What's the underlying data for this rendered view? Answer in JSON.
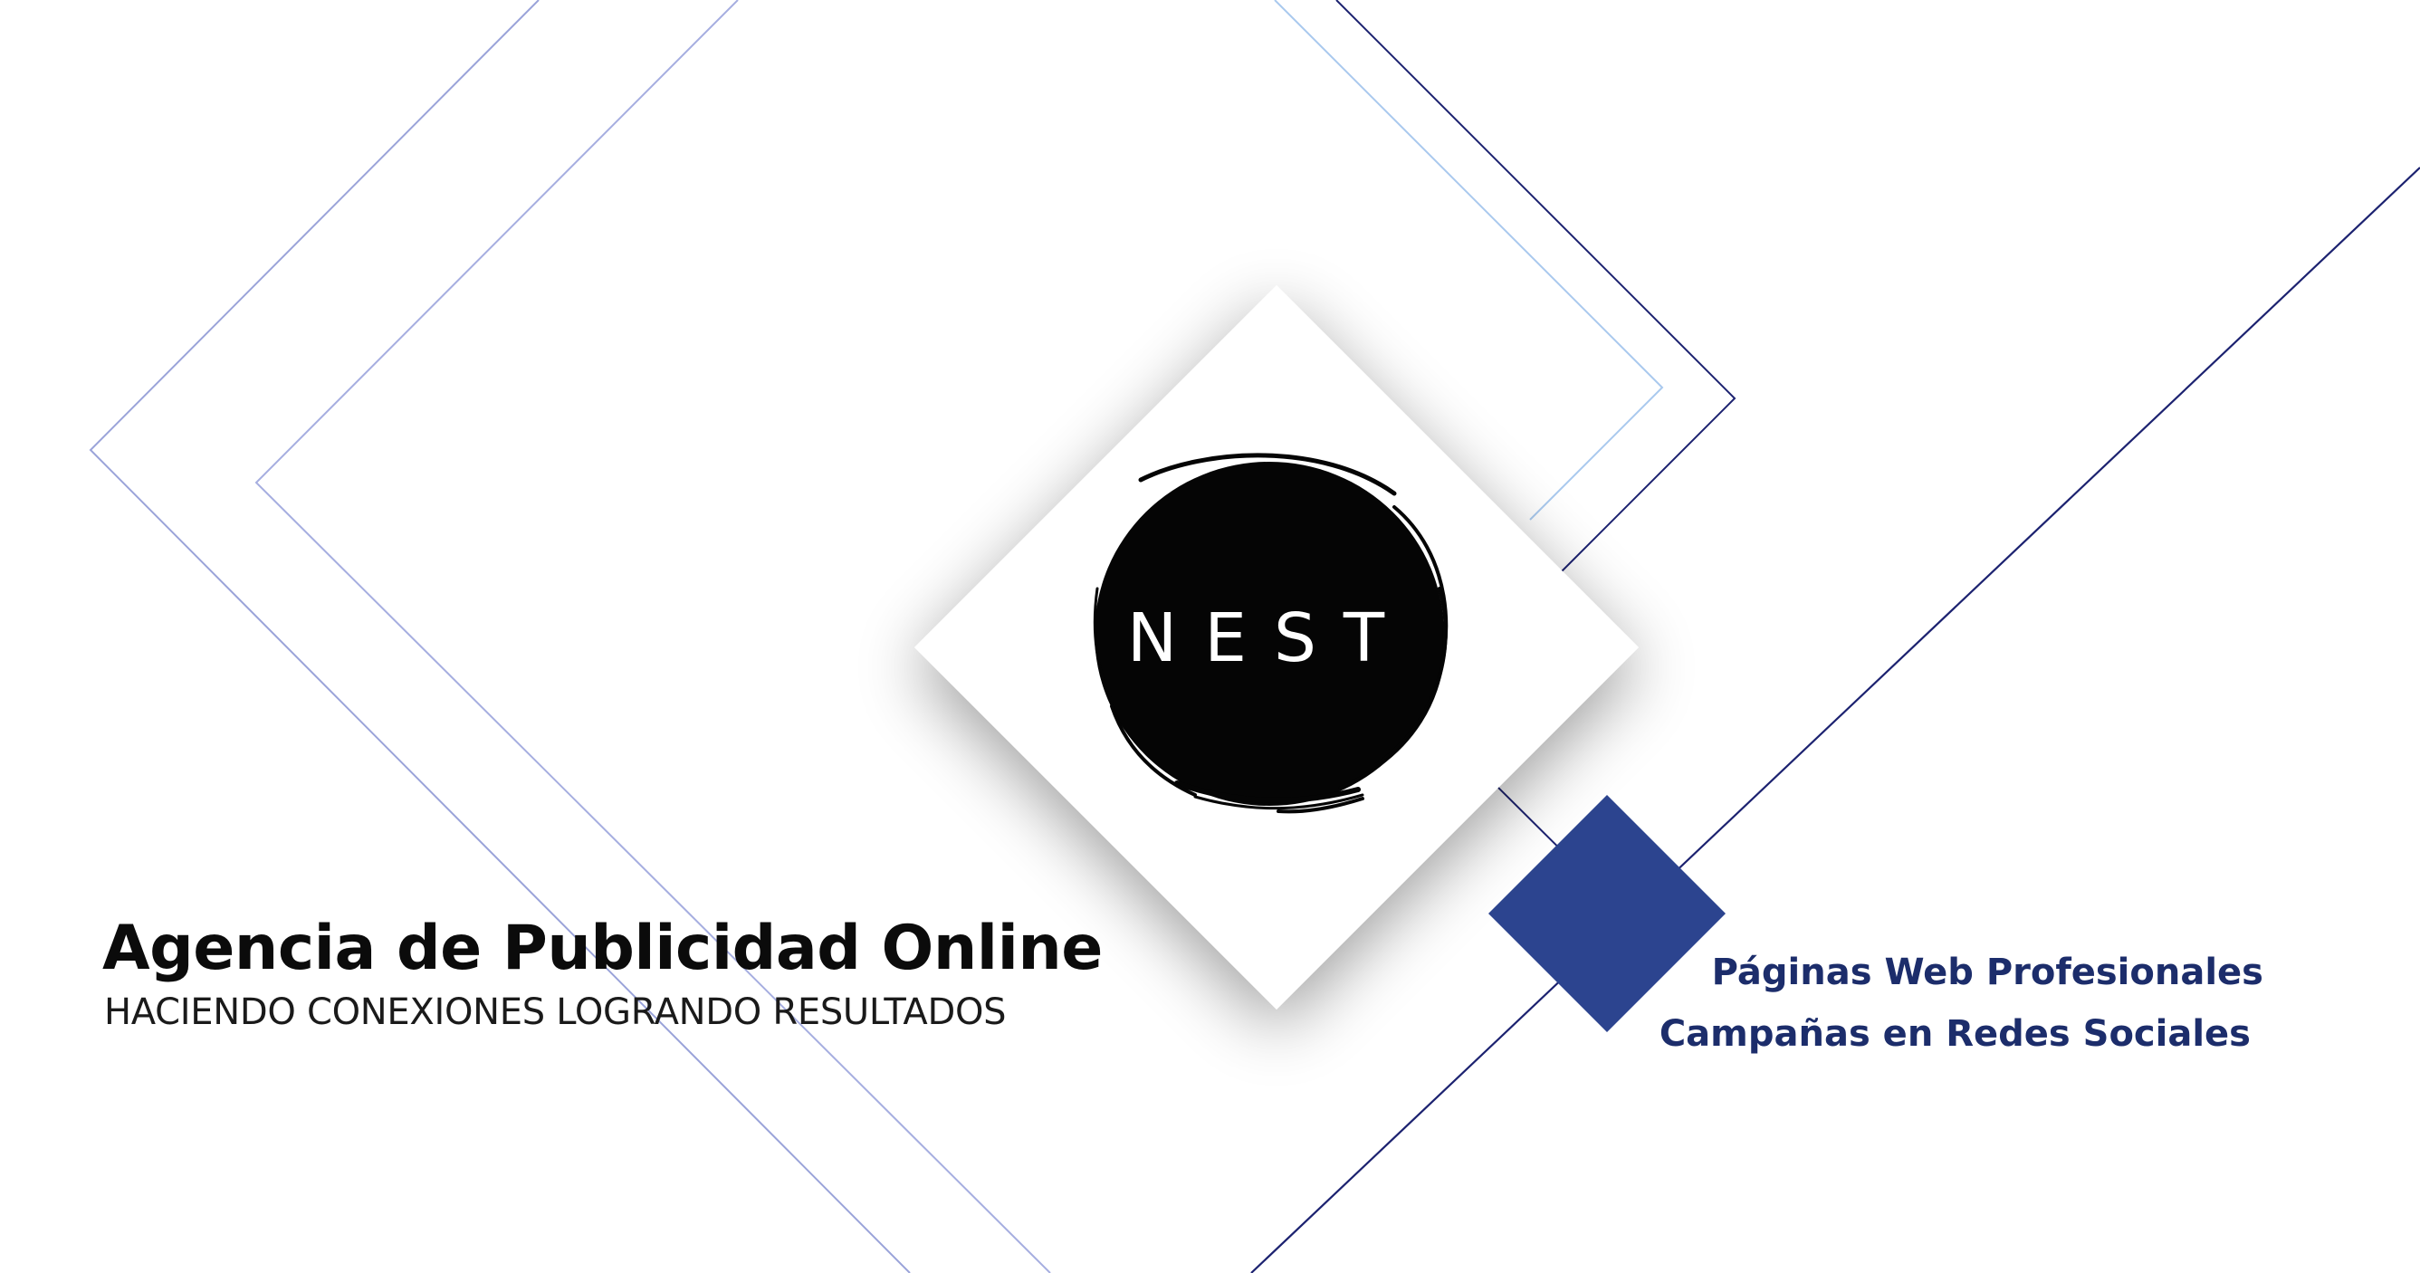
{
  "brand": {
    "logo_text": "NEST"
  },
  "headline": "Agencia de Publicidad Online",
  "tagline": "HACIENDO CONEXIONES LOGRANDO RESULTADOS",
  "services": [
    "Páginas Web Profesionales",
    "Campañas en Redes Sociales"
  ],
  "colors": {
    "background": "#ffffff",
    "navy_line": "#1c2270",
    "lavender_line": "#9aa3d9",
    "light_blue_line": "#a9c9ee",
    "accent_square": "#2c448f",
    "service_text": "#1c2d6b",
    "logo_circle": "#050505",
    "headline_text": "#0b0b0b"
  }
}
